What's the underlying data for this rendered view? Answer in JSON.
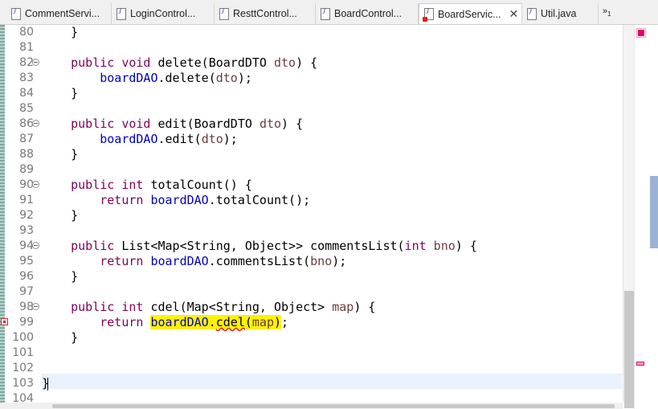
{
  "tabs": [
    {
      "label": "CommentServi...",
      "active": false,
      "error": false
    },
    {
      "label": "LoginControl...",
      "active": false,
      "error": false
    },
    {
      "label": "ResttControl...",
      "active": false,
      "error": false
    },
    {
      "label": "BoardControl...",
      "active": false,
      "error": false
    },
    {
      "label": "BoardServic...",
      "active": true,
      "error": true
    },
    {
      "label": "Util.java",
      "active": false,
      "error": false
    }
  ],
  "overflow": {
    "symbol": "»",
    "count": "1"
  },
  "editor": {
    "lines": [
      {
        "n": "80",
        "code": "    }"
      },
      {
        "n": "81",
        "code": ""
      },
      {
        "n": "82",
        "code": "    public void delete(BoardDTO dto) {"
      },
      {
        "n": "83",
        "code": "        boardDAO.delete(dto);"
      },
      {
        "n": "84",
        "code": "    }"
      },
      {
        "n": "85",
        "code": ""
      },
      {
        "n": "86",
        "code": "    public void edit(BoardDTO dto) {"
      },
      {
        "n": "87",
        "code": "        boardDAO.edit(dto);"
      },
      {
        "n": "88",
        "code": "    }"
      },
      {
        "n": "89",
        "code": ""
      },
      {
        "n": "90",
        "code": "    public int totalCount() {"
      },
      {
        "n": "91",
        "code": "        return boardDAO.totalCount();"
      },
      {
        "n": "92",
        "code": "    }"
      },
      {
        "n": "93",
        "code": ""
      },
      {
        "n": "94",
        "code": "    public List<Map<String, Object>> commentsList(int bno) {"
      },
      {
        "n": "95",
        "code": "        return boardDAO.commentsList(bno);"
      },
      {
        "n": "96",
        "code": "    }"
      },
      {
        "n": "97",
        "code": ""
      },
      {
        "n": "98",
        "code": "    public int cdel(Map<String, Object> map) {"
      },
      {
        "n": "99",
        "code": "        return boardDAO.cdel(map);"
      },
      {
        "n": "100",
        "code": "    }"
      },
      {
        "n": "101",
        "code": ""
      },
      {
        "n": "102",
        "code": ""
      },
      {
        "n": "103",
        "code": "}"
      },
      {
        "n": "104",
        "code": ""
      }
    ]
  }
}
